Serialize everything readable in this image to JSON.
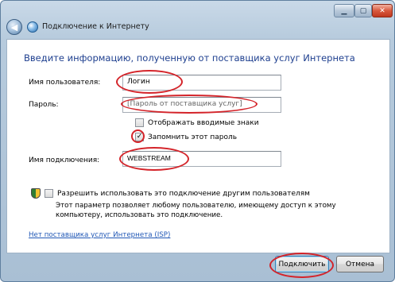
{
  "window": {
    "title": "Подключение к Интернету",
    "buttons": {
      "minimize": "▁",
      "maximize": "▢",
      "close": "✕"
    }
  },
  "main": {
    "heading": "Введите информацию, полученную от поставщика услуг Интернета",
    "username": {
      "label": "Имя пользователя:",
      "value": "Логин"
    },
    "password": {
      "label": "Пароль:",
      "value": "[Пароль от поставщика услуг]"
    },
    "show_chars": {
      "label": "Отображать вводимые знаки",
      "checked": false
    },
    "remember": {
      "label": "Запомнить этот пароль",
      "checked": true,
      "mark": "✓"
    },
    "connection_name": {
      "label": "Имя подключения:",
      "value": "WEBSTREAM"
    },
    "allow_others": {
      "label": "Разрешить использовать это подключение другим пользователям",
      "checked": false,
      "description": "Этот параметр позволяет любому пользователю, имеющему доступ к этому компьютеру, использовать это подключение."
    },
    "no_isp_link": "Нет поставщика услуг Интернета (ISP)"
  },
  "footer": {
    "connect": "Подключить",
    "cancel": "Отмена"
  },
  "colors": {
    "heading": "#1e3f8f",
    "link": "#2158b6",
    "highlight": "#d4242a"
  }
}
